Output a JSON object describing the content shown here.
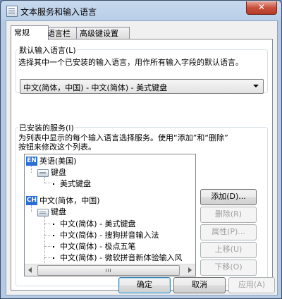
{
  "window": {
    "title": "文本服务和输入语言",
    "close_symbol": "✕"
  },
  "tabs": [
    {
      "label": "常规",
      "active": true
    },
    {
      "label": "语言栏",
      "active": false
    },
    {
      "label": "高级键设置",
      "active": false
    }
  ],
  "default_input": {
    "legend": "默认输入语言(L)",
    "description": "选择其中一个已安装的输入语言，用作所有输入字段的默认语言。",
    "selected": "中文(简体，中国) - 中文(简体) - 美式键盘"
  },
  "installed_services": {
    "legend": "已安装的服务(I)",
    "description_line1": "为列表中显示的每个输入语言选择服务。使用“添加”和“删除”",
    "description_line2": "按钮来修改这个列表。",
    "tree": {
      "lang1": {
        "badge": "EN",
        "name": "英语(美国)",
        "group": "键盘",
        "items": [
          "美式键盘"
        ]
      },
      "lang2": {
        "badge": "CH",
        "name": "中文(简体，中国)",
        "group": "键盘",
        "items": [
          "中文(简体) - 美式键盘",
          "中文(简体) - 搜狗拼音输入法",
          "中文(简体) - 极点五笔",
          "中文(简体) - 微软拼音新体验输入风"
        ]
      }
    },
    "buttons": {
      "add": "添加(D)...",
      "remove": "删除(R)",
      "properties": "属性(P)...",
      "move_up": "上移(U)",
      "move_down": "下移(O)"
    }
  },
  "footer": {
    "ok": "确定",
    "cancel": "取消",
    "apply": "应用(A)"
  },
  "colors": {
    "lang_badge": "#2b6fd6",
    "close_button": "#c8503c",
    "default_button_border": "#3c7fb1"
  }
}
